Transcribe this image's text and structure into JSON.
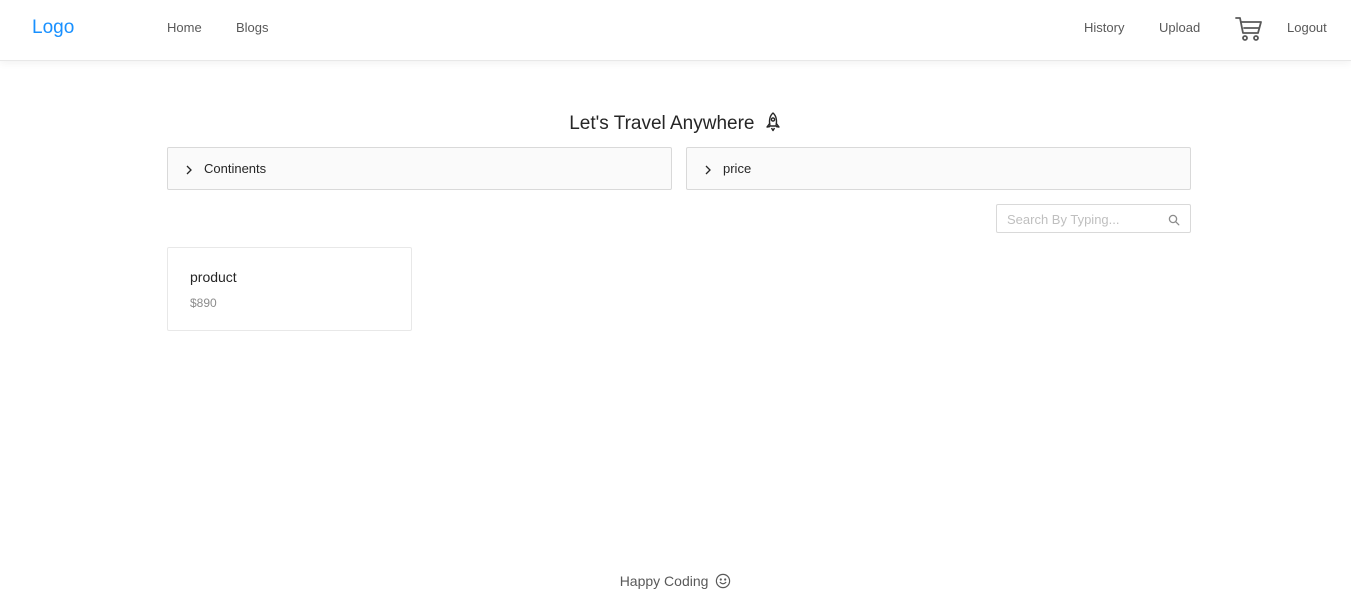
{
  "navbar": {
    "logo": "Logo",
    "left_links": [
      "Home",
      "Blogs"
    ],
    "right_links": [
      "History",
      "Upload"
    ],
    "cart_icon": "shopping-cart-icon",
    "logout": "Logout"
  },
  "main": {
    "title": "Let's Travel Anywhere",
    "title_icon": "rocket-icon",
    "filters": [
      {
        "label": "Continents",
        "icon": "chevron-right-icon"
      },
      {
        "label": "price",
        "icon": "chevron-right-icon"
      }
    ],
    "search": {
      "placeholder": "Search By Typing...",
      "value": "",
      "icon": "search-icon"
    },
    "products": [
      {
        "title": "product",
        "price": "$890"
      }
    ]
  },
  "footer": {
    "text": "Happy Coding",
    "icon": "smile-icon"
  },
  "colors": {
    "accent": "#1890ff",
    "text": "#262626",
    "muted": "#8c8c8c",
    "border": "#d9d9d9",
    "panel_bg": "#fafafa"
  }
}
